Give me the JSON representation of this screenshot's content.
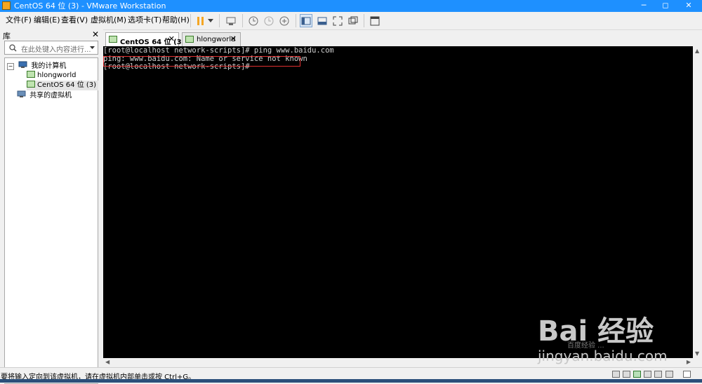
{
  "window": {
    "title": "CentOS 64 位 (3) - VMware Workstation",
    "min": "─",
    "max": "◻",
    "close": "✕"
  },
  "menu": [
    "文件(F)",
    "编辑(E)",
    "查看(V)",
    "虚拟机(M)",
    "选项卡(T)",
    "帮助(H)"
  ],
  "library": {
    "title": "库",
    "close": "✕",
    "search_placeholder": "在此处键入内容进行...",
    "tree": {
      "my_computer": "我的计算机",
      "vms": [
        "hlongworld",
        "CentOS 64 位 (3)"
      ],
      "shared": "共享的虚拟机"
    }
  },
  "tabs": [
    {
      "label": "CentOS 64 位 (3)",
      "active": true
    },
    {
      "label": "hlongworld",
      "active": false
    }
  ],
  "terminal": [
    "[root@localhost network-scripts]# ping www.baidu.com",
    "ping: www.baidu.com: Name or service not known",
    "[root@localhost network-scripts]#"
  ],
  "status": {
    "message": "要将输入定向到该虚拟机，请在虚拟机内部单击或按 Ctrl+G。"
  },
  "watermark": {
    "brand": "Bai 经验",
    "subtitle": "百度经验 ...",
    "url": "jingyan.baidu.com"
  },
  "colors": {
    "titlebar": "#1e90ff",
    "console_bg": "#000000",
    "highlight": "#e03030",
    "pause": "#f5a623"
  }
}
